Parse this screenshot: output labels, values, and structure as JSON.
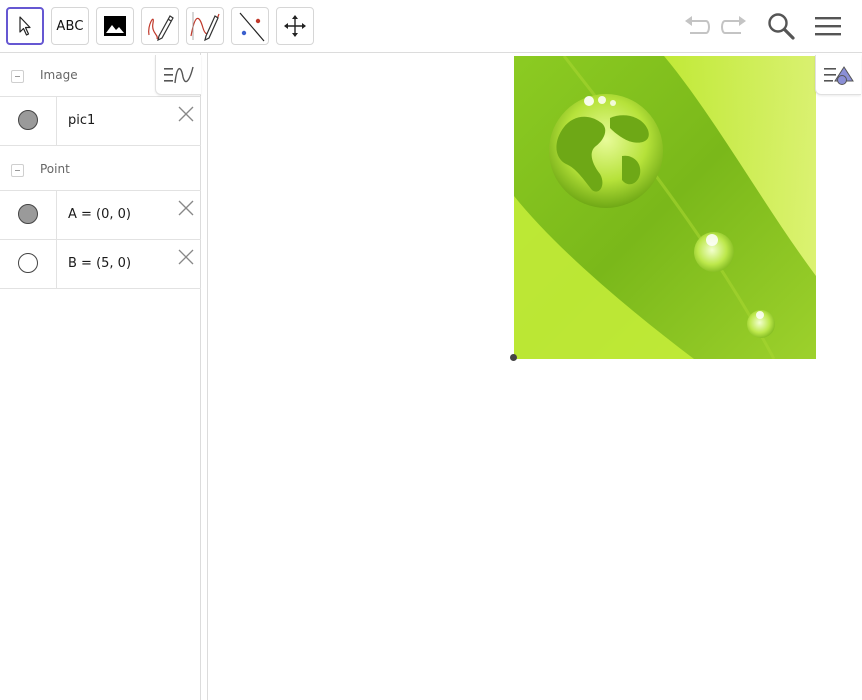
{
  "toolbar": {
    "tools": [
      {
        "name": "move-tool",
        "icon": "pointer-arrow-icon",
        "selected": true
      },
      {
        "name": "text-tool",
        "label": "ABC"
      },
      {
        "name": "image-tool",
        "icon": "image-icon"
      },
      {
        "name": "pen-tool",
        "icon": "pen-curve-icon"
      },
      {
        "name": "function-inspector-tool",
        "icon": "function-curve-icon"
      },
      {
        "name": "line-tool",
        "icon": "line-through-points-icon"
      },
      {
        "name": "move-graphics-tool",
        "icon": "move-cross-arrows-icon"
      }
    ],
    "actions": [
      "undo-icon",
      "redo-icon",
      "search-icon",
      "menu-icon"
    ]
  },
  "algebra": {
    "groups": [
      {
        "label": "Image",
        "items": [
          {
            "text": "pic1",
            "marker": "filled",
            "color": "#9a9a9a"
          }
        ]
      },
      {
        "label": "Point",
        "items": [
          {
            "text": "A = (0, 0)",
            "marker": "filled",
            "color": "#9a9a9a"
          },
          {
            "text": "B = (5, 0)",
            "marker": "empty",
            "color": "#ffffff"
          }
        ]
      }
    ]
  },
  "colors": {
    "accent": "#6557d2",
    "picture_green": "#86c41c",
    "point": "#444444"
  }
}
